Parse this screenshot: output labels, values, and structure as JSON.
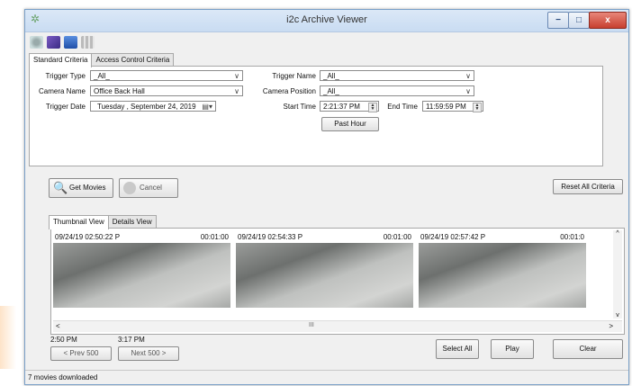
{
  "window": {
    "title": "i2c Archive Viewer",
    "minimize": "−",
    "maximize": "□",
    "close": "x"
  },
  "toolbar": {
    "icons": [
      "tools-icon",
      "export-icon",
      "monitor-icon",
      "grid-icon"
    ]
  },
  "criteria": {
    "tabs": [
      "Standard Criteria",
      "Access Control Criteria"
    ],
    "trigger_type_label": "Trigger Type",
    "trigger_type_value": "_All_",
    "camera_name_label": "Camera Name",
    "camera_name_value": "Office Back Hall",
    "trigger_date_label": "Trigger Date",
    "trigger_date_value": "Tuesday  , September 24, 2019",
    "trigger_name_label": "Trigger Name",
    "trigger_name_value": "_All_",
    "camera_position_label": "Camera Position",
    "camera_position_value": "_All_",
    "start_time_label": "Start Time",
    "start_time_value": "2:21:37 PM",
    "end_time_label": "End Time",
    "end_time_value": "11:59:59 PM",
    "past_hour_label": "Past Hour"
  },
  "actions": {
    "get_movies": "Get Movies",
    "cancel": "Cancel",
    "reset_all": "Reset All Criteria"
  },
  "view_tabs": [
    "Thumbnail View",
    "Details View"
  ],
  "thumbnails": [
    {
      "timestamp": "09/24/19 02:50:22 P",
      "duration": "00:01:00"
    },
    {
      "timestamp": "09/24/19 02:54:33 P",
      "duration": "00:01:00"
    },
    {
      "timestamp": "09/24/19 02:57:42 P",
      "duration": "00:01:0"
    }
  ],
  "scroll": {
    "left": "<",
    "right": ">",
    "grip": "III",
    "up": "^",
    "down": "v"
  },
  "paging": {
    "start_time": "2:50 PM",
    "end_time": "3:17 PM",
    "prev": "< Prev 500",
    "next": "Next 500 >"
  },
  "bottom_buttons": {
    "select_all": "Select All",
    "play": "Play",
    "clear": "Clear"
  },
  "status": "7 movies downloaded"
}
